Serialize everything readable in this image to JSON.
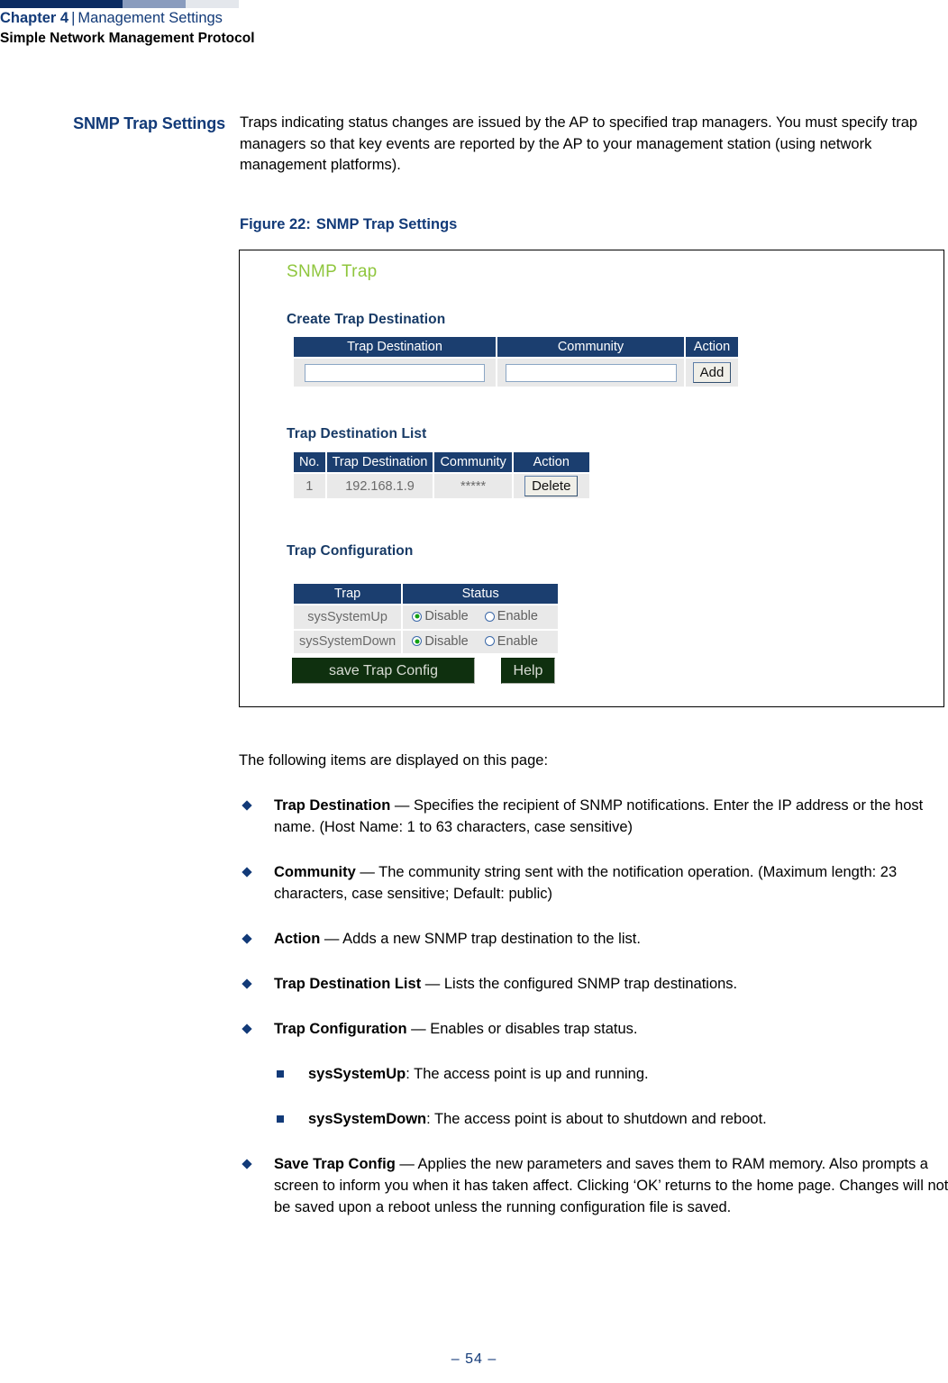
{
  "header": {
    "chapter": "Chapter 4",
    "separator": "|",
    "section": "Management Settings",
    "subsection": "Simple Network Management Protocol"
  },
  "side_heading": "SNMP Trap Settings",
  "intro_paragraph": "Traps indicating status changes are issued by the AP to specified trap managers. You must specify trap managers so that key events are reported by the AP to your management station (using network management platforms).",
  "figure": {
    "caption_label": "Figure 22:",
    "caption_text": "SNMP Trap Settings",
    "webui": {
      "title": "SNMP Trap",
      "accent_green": "#8fc63d",
      "header_navy": "#1b3e6f",
      "row_gray": "#e9e9e9",
      "button_green": "#0f300f",
      "create_section": {
        "heading": "Create Trap Destination",
        "columns": [
          "Trap Destination",
          "Community",
          "Action"
        ],
        "trap_destination_value": "",
        "community_value": "",
        "add_button": "Add"
      },
      "list_section": {
        "heading": "Trap Destination List",
        "columns": [
          "No.",
          "Trap Destination",
          "Community",
          "Action"
        ],
        "rows": [
          {
            "no": "1",
            "destination": "192.168.1.9",
            "community": "*****",
            "action": "Delete"
          }
        ]
      },
      "config_section": {
        "heading": "Trap Configuration",
        "columns": [
          "Trap",
          "Status"
        ],
        "rows": [
          {
            "trap": "sysSystemUp",
            "disable_label": "Disable",
            "enable_label": "Enable",
            "selected": "Disable"
          },
          {
            "trap": "sysSystemDown",
            "disable_label": "Disable",
            "enable_label": "Enable",
            "selected": "Disable"
          }
        ],
        "save_button": "save Trap Config",
        "help_button": "Help"
      }
    }
  },
  "lead_in": "The following items are displayed on this page:",
  "items": [
    {
      "term": "Trap Destination",
      "dash": " — ",
      "description": "Specifies the recipient of SNMP notifications. Enter the IP address or the host name. (Host Name: 1 to 63 characters, case sensitive)"
    },
    {
      "term": "Community",
      "dash": " — ",
      "description": "The community string sent with the notification operation. (Maximum length: 23 characters, case sensitive; Default: public)"
    },
    {
      "term": "Action",
      "dash": " — ",
      "description": "Adds a new SNMP trap destination to the list."
    },
    {
      "term": "Trap Destination List",
      "dash": " — ",
      "description": "Lists the configured SNMP trap destinations."
    },
    {
      "term": "Trap Configuration",
      "dash": " — ",
      "description": "Enables or disables trap status."
    }
  ],
  "sub_items": [
    {
      "term": "sysSystemUp",
      "dash": ": ",
      "description": "The access point is up and running."
    },
    {
      "term": "sysSystemDown",
      "dash": ": ",
      "description": "The access point is about to shutdown and reboot."
    }
  ],
  "final_item": {
    "term": "Save Trap Config",
    "dash": " — ",
    "description": "Applies the new parameters and saves them to RAM memory. Also prompts a screen to inform you when it has taken affect. Clicking ‘OK’ returns to the home page. Changes will not be saved upon a reboot unless the running configuration file is saved."
  },
  "footer": {
    "page_number": "–  54  –"
  }
}
